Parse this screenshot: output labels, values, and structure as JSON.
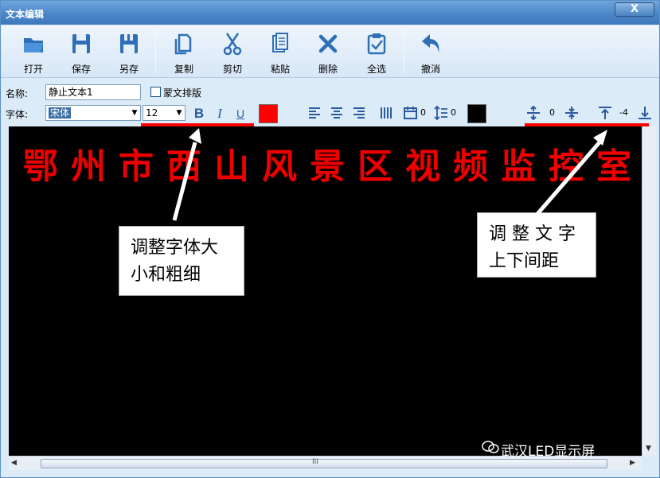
{
  "window": {
    "title": "文本编辑",
    "close_glyph": "X"
  },
  "toolbar": {
    "open": "打开",
    "save": "保存",
    "save_as": "另存",
    "copy": "复制",
    "cut": "剪切",
    "paste": "粘贴",
    "delete": "删除",
    "select_all": "全选",
    "undo": "撤消"
  },
  "form": {
    "name_label": "名称:",
    "name_value": "静止文本1",
    "mongolian_layout_label": "蒙文排版",
    "font_label": "字体:",
    "font_value": "宋体",
    "size_value": "12",
    "bold": "B",
    "italic": "I",
    "underline": "U",
    "text_color": "#ff0000",
    "char_spacing_value": "0",
    "line_spacing_value": "0",
    "bg_color": "#000000",
    "spacing_a_value": "0",
    "spacing_b_value": "-4"
  },
  "editor": {
    "content": "鄂州市西山风景区视频监控室"
  },
  "annotations": {
    "font_callout_line1": "调整字体大",
    "font_callout_line2": "小和粗细",
    "spacing_callout_line1": "调 整 文 字",
    "spacing_callout_line2": "上下间距"
  },
  "watermark": {
    "text": "武汉LED显示屏"
  },
  "scrollbar": {
    "grip": "III"
  },
  "icons": [
    "folder-open-icon",
    "floppy-disk-icon",
    "save-as-icon",
    "copy-icon",
    "scissors-icon",
    "paste-icon",
    "delete-x-icon",
    "select-all-icon",
    "undo-arrow-icon"
  ]
}
